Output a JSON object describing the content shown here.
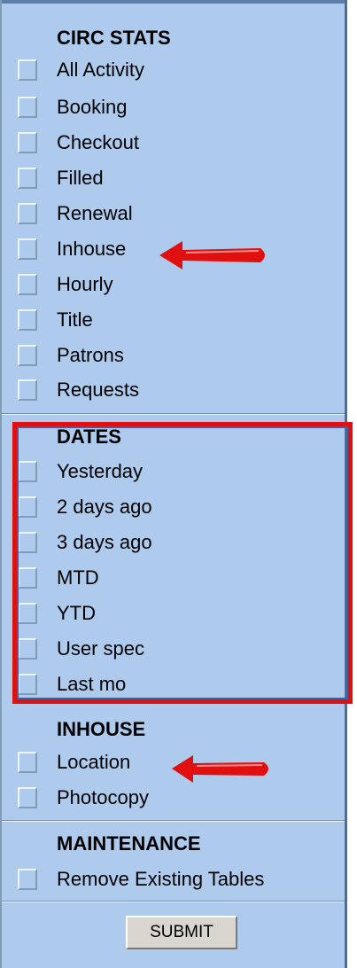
{
  "sections": {
    "circ_stats": {
      "heading": "CIRC STATS",
      "items": [
        {
          "label": "All Activity"
        },
        {
          "label": "Booking"
        },
        {
          "label": "Checkout"
        },
        {
          "label": "Filled"
        },
        {
          "label": "Renewal"
        },
        {
          "label": "Inhouse"
        },
        {
          "label": "Hourly"
        },
        {
          "label": "Title"
        },
        {
          "label": "Patrons"
        },
        {
          "label": "Requests"
        }
      ]
    },
    "dates": {
      "heading": "DATES",
      "items": [
        {
          "label": "Yesterday"
        },
        {
          "label": "2 days ago"
        },
        {
          "label": "3 days ago"
        },
        {
          "label": "MTD"
        },
        {
          "label": "YTD"
        },
        {
          "label": "User spec"
        },
        {
          "label": "Last mo"
        }
      ]
    },
    "inhouse": {
      "heading": "INHOUSE",
      "items": [
        {
          "label": "Location"
        },
        {
          "label": "Photocopy"
        }
      ]
    },
    "maintenance": {
      "heading": "MAINTENANCE",
      "items": [
        {
          "label": "Remove Existing Tables"
        }
      ]
    }
  },
  "submit": {
    "label": "SUBMIT"
  },
  "annotations": {
    "arrow_color": "#e01010",
    "highlight_color": "#e01010",
    "panel_color": "#aecbee"
  }
}
